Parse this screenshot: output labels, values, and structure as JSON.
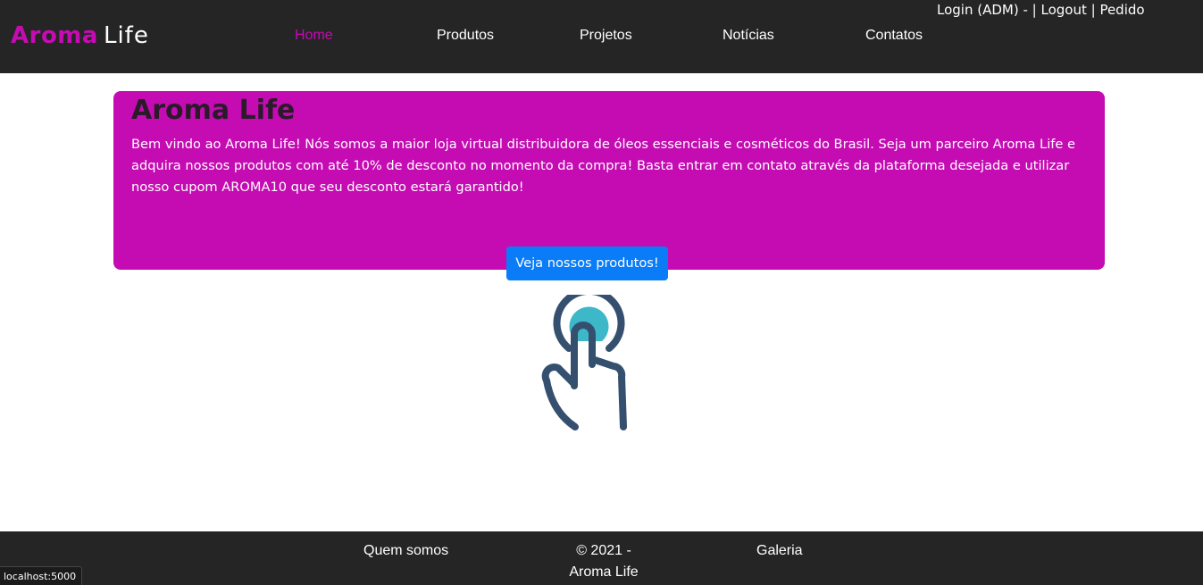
{
  "header": {
    "logo_primary": "Aroma",
    "logo_secondary": "Life",
    "nav": [
      {
        "label": "Home",
        "active": true
      },
      {
        "label": "Produtos"
      },
      {
        "label": "Projetos"
      },
      {
        "label": "Notícias"
      },
      {
        "label": "Contatos"
      }
    ],
    "account": {
      "login": "Login (ADM)",
      "sep1": " - | ",
      "logout": "Logout",
      "sep2": " | ",
      "order": "Pedido"
    }
  },
  "hero": {
    "title": "Aroma Life",
    "text": "Bem vindo ao Aroma Life! Nós somos a maior loja virtual distribuidora de óleos essenciais e cosméticos do Brasil. Seja um parceiro Aroma Life e adquira nossos produtos com até 10% de desconto no momento da compra! Basta entrar em contato através da plataforma desejada e utilizar nosso cupom AROMA10 que seu desconto estará garantido!",
    "button_label": "Veja nossos produtos!"
  },
  "illustration": {
    "icon": "tap-hand-icon",
    "colors": {
      "outline": "#35506f",
      "accent": "#3cb8c8"
    }
  },
  "footer": {
    "about": "Quem somos",
    "copyright_line1": "© 2021 -",
    "copyright_line2": "Aroma Life",
    "gallery": "Galeria"
  },
  "status_bar": {
    "url": "localhost:5000"
  },
  "colors": {
    "brand": "#c40cb2",
    "dark_bar": "#252525",
    "button": "#0a7cf7"
  }
}
